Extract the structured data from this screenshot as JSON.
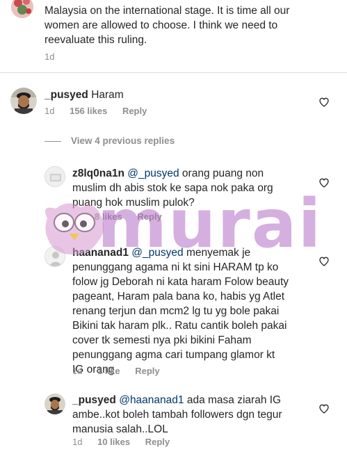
{
  "comment0": {
    "text_lines": [
      "Malaysia on the international stage. It is time all our",
      "women are allowed to choose. I think we need to",
      "reevaluate this ruling."
    ],
    "time": "1d"
  },
  "comment1": {
    "username": "_pusyed",
    "text": "Haram",
    "time": "1d",
    "likes": "156 likes",
    "reply": "Reply"
  },
  "view_replies": "View 4 previous replies",
  "reply1": {
    "username": "z8lq0na1n",
    "mention": "@_pusyed",
    "line1_rest": "orang puang non",
    "lines": [
      "muslim dh abis stok ke sapa nok paka org",
      "puang hok muslim pulok?"
    ],
    "likes": "8 likes",
    "reply": "Reply"
  },
  "reply2": {
    "username": "haananad1",
    "mention": "@_pusyed",
    "line1_rest": "menyemak je",
    "lines": [
      "penunggang agama ni kt sini HARAM tp ko",
      "folow jg Deborah ni kata haram Folow beauty",
      "pageant, Haram pala bana ko, habis yg Atlet",
      "renang terjun dan mcm2 lg tu yg bole pakai",
      "Bikini tak haram plk.. Ratu cantik boleh pakai",
      "cover tk semesti nya pki bikini Faham",
      "penunggang agma cari tumpang glamor kt",
      "IG orang"
    ],
    "time": "1d",
    "likes": "1 like",
    "reply": "Reply"
  },
  "reply3": {
    "username": "_pusyed",
    "mention": "@haananad1",
    "line1_rest": "ada masa ziarah IG",
    "lines": [
      "ambe..kot boleh tambah followers dgn tegur",
      "manusia salah..LOL"
    ],
    "time": "1d",
    "likes": "10 likes",
    "reply": "Reply"
  },
  "watermark": {
    "text": "murai",
    "color": "#b26ec4"
  },
  "icons": {
    "like": "heart-outline-icon"
  }
}
